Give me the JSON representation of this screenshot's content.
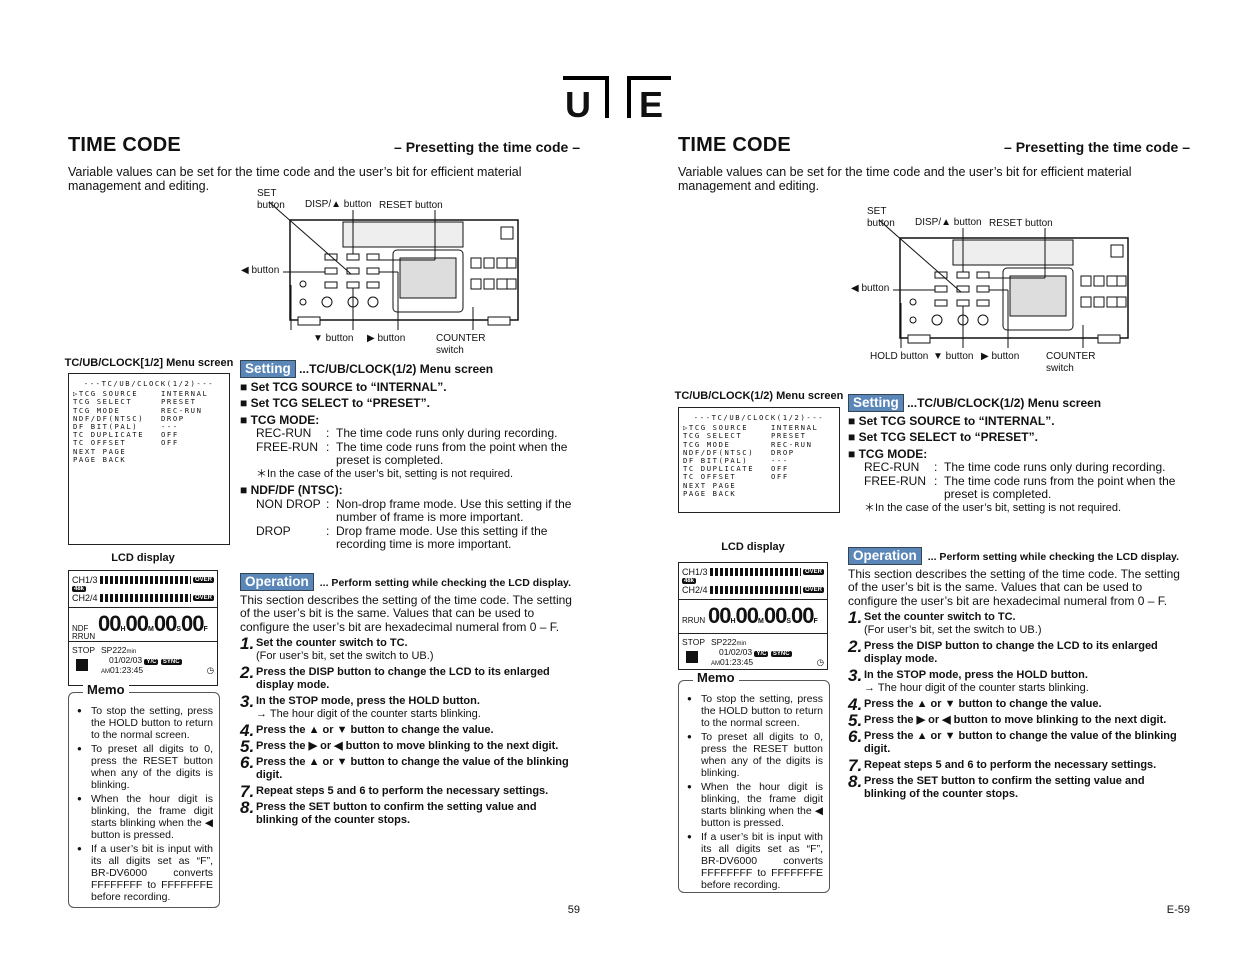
{
  "header": {
    "tab_u": "U",
    "tab_e": "E"
  },
  "doc": {
    "title": "TIME CODE",
    "subtitle": "– Presetting the time code –",
    "intro": "Variable values can be set for the time code and the user’s bit for efficient material management and editing.",
    "diagram": {
      "set": "SET\nbutton",
      "disp": "DISP/▲ button",
      "reset": "RESET button",
      "left": "◀ button",
      "down": "▼ button",
      "right": "▶ button",
      "counter": "COUNTER\nswitch",
      "model": "BR-DV6000"
    },
    "menu": {
      "head": "---TC/UB/CLOCK(1/2)---",
      "rows": [
        [
          "▷TCG SOURCE",
          "INTERNAL"
        ],
        [
          "TCG SELECT",
          "PRESET"
        ],
        [
          "TCG MODE",
          "REC-RUN"
        ],
        [
          "NDF/DF(NTSC)",
          "DROP"
        ],
        [
          "DF BIT(PAL)",
          "---"
        ],
        [
          "TC DUPLICATE",
          "OFF"
        ],
        [
          "TC OFFSET",
          "OFF"
        ],
        [
          "NEXT PAGE",
          ""
        ],
        [
          "PAGE BACK",
          ""
        ]
      ]
    },
    "setting": {
      "badge": "Setting",
      "heading": "...TC/UB/CLOCK(1/2) Menu screen",
      "items": [
        "Set TCG SOURCE to “INTERNAL”.",
        "Set TCG SELECT to “PRESET”.",
        "TCG MODE:"
      ],
      "modes": [
        {
          "k": "REC-RUN",
          "v": "The time code runs only during recording."
        },
        {
          "k": "FREE-RUN",
          "v": "The time code runs from the point when the preset is completed."
        }
      ],
      "note": "＊In the case of the user’s bit, setting is not required.",
      "ndf_title": "NDF/DF (NTSC):",
      "ndf": [
        {
          "k": "NON DROP",
          "v": "Non-drop frame mode. Use this setting if the number of frame is more important."
        },
        {
          "k": "DROP",
          "v": "Drop frame mode. Use this setting if the recording time is more important."
        }
      ]
    },
    "lcd": {
      "label": "LCD display",
      "ch1": "CH1/3",
      "ch2": "CH2/4",
      "over": "OVER",
      "khz": "48k",
      "h": "00",
      "m": "00",
      "s": "00",
      "f": "00",
      "stop": "STOP",
      "tape": "SP222",
      "min": "min",
      "date": "01/02/03",
      "am": "AM",
      "time": "01:23:45",
      "yc": "Y/C",
      "sync": "SYNC"
    },
    "operation": {
      "badge": "Operation",
      "heading": "... Perform setting while checking the LCD display.",
      "desc": "This section describes the setting of the time code. The setting of the user’s bit is the same. Values that can be used to configure the user’s bit are hexadecimal numeral from 0 – F.",
      "steps": [
        {
          "n": "1.",
          "t": "Set the counter switch to TC.",
          "s": "(For user’s bit, set the switch to UB.)"
        },
        {
          "n": "2.",
          "t": "Press the DISP button to change the LCD to its enlarged display mode.",
          "s": ""
        },
        {
          "n": "3.",
          "t": "In the STOP mode, press the HOLD button.",
          "s": "→ The hour digit of the counter starts blinking."
        },
        {
          "n": "4.",
          "t": "Press the ▲ or ▼ button to change the value.",
          "s": ""
        },
        {
          "n": "5.",
          "t": "Press the ▶ or ◀ button to move blinking to the next digit.",
          "s": ""
        },
        {
          "n": "6.",
          "t": "Press the ▲ or ▼ button to change the value of the blinking digit.",
          "s": ""
        },
        {
          "n": "7.",
          "t": "Repeat steps 5 and 6 to perform the necessary settings.",
          "s": ""
        },
        {
          "n": "8.",
          "t": "Press the SET button to confirm the setting value and blinking of the counter stops.",
          "s": ""
        }
      ]
    },
    "memo": {
      "title": "Memo",
      "items": [
        "To stop the setting, press the HOLD button to return to the normal screen.",
        "To preset all digits to 0, press the RESET button when any of the digits is blinking.",
        "When the hour digit is blinking, the frame digit starts blinking when the ◀ button is pressed.",
        "If a user’s bit is input with its all digits set as “F”, BR-DV6000 converts FFFFFFFF to FFFFFFFE before recording."
      ]
    }
  },
  "pages": [
    {
      "menu_label": "TC/UB/CLOCK[1/2] Menu screen",
      "lcd_mode": "NDF RRUN",
      "page_number": "59"
    },
    {
      "menu_label": "TC/UB/CLOCK(1/2) Menu screen",
      "lcd_mode": "RRUN",
      "hold": "HOLD button",
      "page_number": "E-59"
    }
  ]
}
